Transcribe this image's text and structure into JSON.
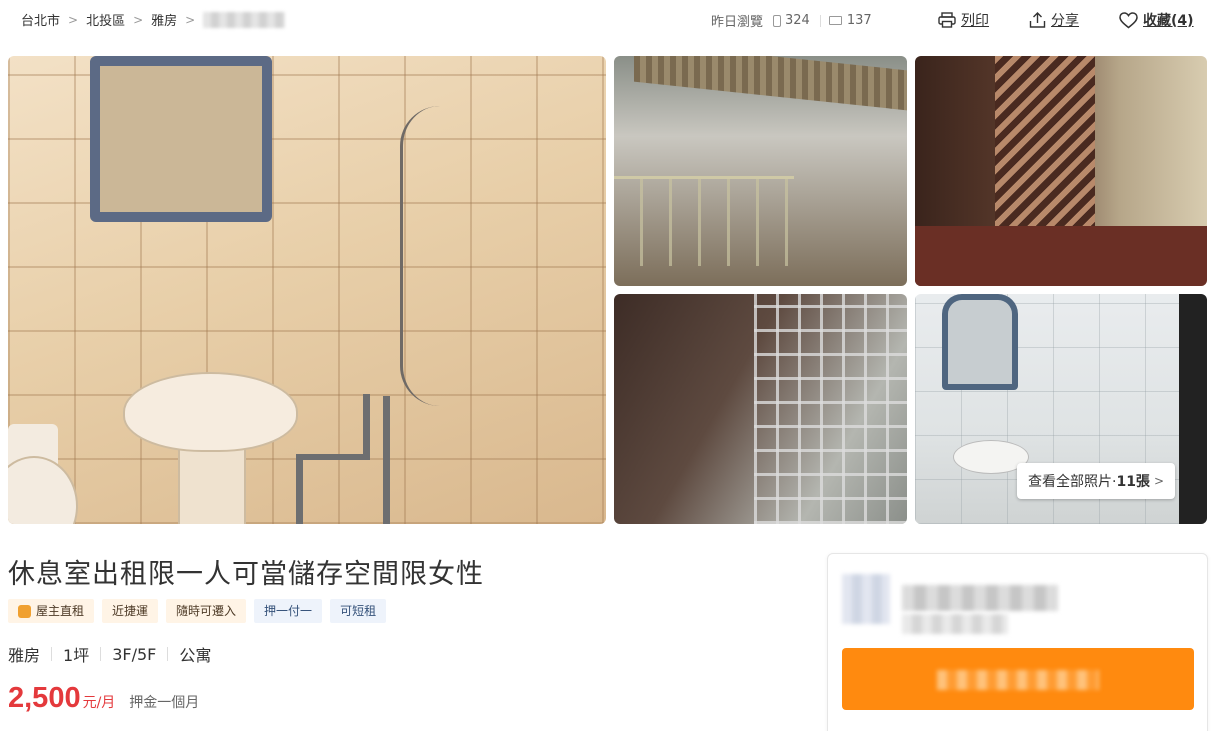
{
  "breadcrumb": {
    "items": [
      "台北市",
      "北投區",
      "雅房"
    ],
    "separator": ">"
  },
  "stats": {
    "label": "昨日瀏覽",
    "mobile_views": "324",
    "desktop_views": "137"
  },
  "actions": {
    "print": "列印",
    "share": "分享",
    "favorite": "收藏(4)"
  },
  "gallery": {
    "see_all_prefix": "查看全部照片·",
    "see_all_count": "11張",
    "chevron": ">"
  },
  "listing": {
    "title": "休息室出租限一人可當儲存空間限女性",
    "tags": [
      {
        "label": "屋主直租",
        "style": "warm"
      },
      {
        "label": "近捷運",
        "style": "warm"
      },
      {
        "label": "隨時可遷入",
        "style": "warm"
      },
      {
        "label": "押一付一",
        "style": "cool"
      },
      {
        "label": "可短租",
        "style": "cool"
      }
    ],
    "specs": [
      "雅房",
      "1坪",
      "3F/5F",
      "公寓"
    ],
    "price": "2,500",
    "price_unit": "元/月",
    "deposit": "押金一個月"
  },
  "colors": {
    "price": "#e4393c",
    "cta": "#ff8a0f",
    "tag_warm_bg": "#fff4e6",
    "tag_cool_bg": "#eef3fb"
  },
  "icons": {
    "print": "printer-icon",
    "share": "share-icon",
    "favorite": "heart-icon",
    "mobile": "mobile-icon",
    "desktop": "desktop-icon",
    "owner": "owner-badge-icon"
  }
}
